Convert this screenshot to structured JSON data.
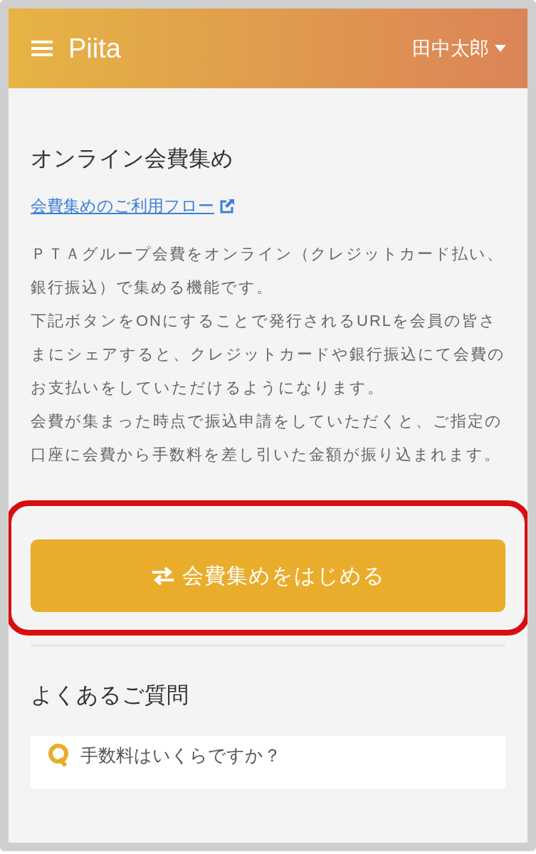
{
  "header": {
    "logo": "Piita",
    "user": "田中太郎"
  },
  "title": "オンライン会費集め",
  "flow_link": "会費集めのご利用フロー",
  "paragraphs": [
    "ＰＴＡグループ会費をオンライン（クレジットカード払い、銀行振込）で集める機能です。",
    "下記ボタンをONにすることで発行されるURLを会員の皆さまにシェアすると、クレジットカードや銀行振込にて会費のお支払いをしていただけるようになります。",
    "会費が集まった時点で振込申請をしていただくと、ご指定の口座に会費から手数料を差し引いた金額が振り込まれます。"
  ],
  "start_button": "会費集めをはじめる",
  "faq": {
    "title": "よくあるご質問",
    "items": [
      {
        "question": "手数料はいくらですか？"
      }
    ]
  }
}
